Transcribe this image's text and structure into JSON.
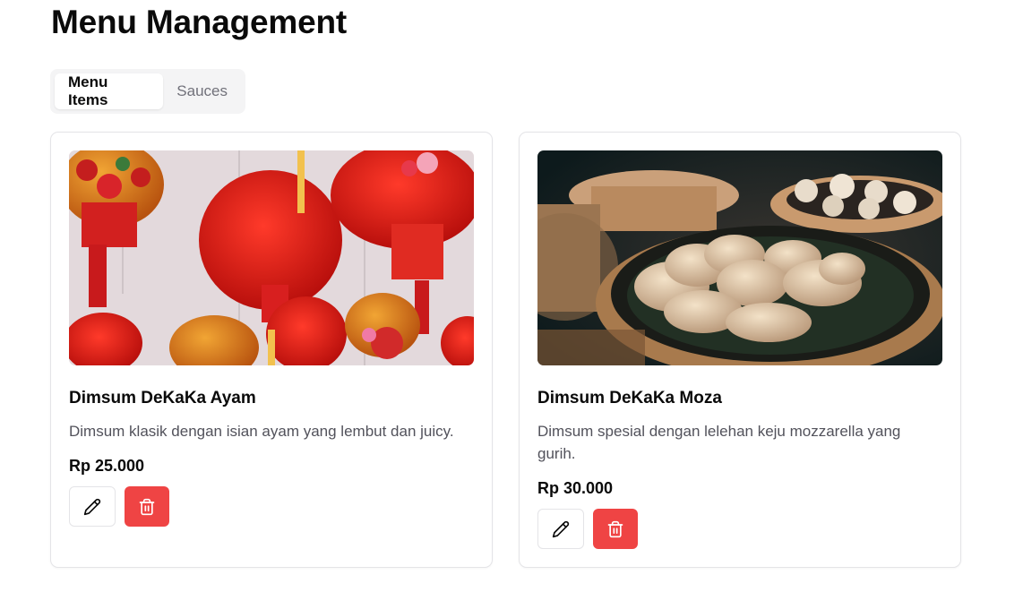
{
  "page": {
    "title": "Menu Management"
  },
  "tabs": [
    {
      "label": "Menu Items",
      "active": true
    },
    {
      "label": "Sauces",
      "active": false
    }
  ],
  "menu_items": [
    {
      "name": "Dimsum DeKaKa Ayam",
      "description": "Dimsum klasik dengan isian ayam yang lembut dan juicy.",
      "price": "Rp 25.000",
      "image": "red-lanterns-photo"
    },
    {
      "name": "Dimsum DeKaKa Moza",
      "description": "Dimsum spesial dengan lelehan keju mozzarella yang gurih.",
      "price": "Rp 30.000",
      "image": "dimsum-steamer-photo"
    }
  ],
  "icons": {
    "edit": "pencil-icon",
    "delete": "trash-icon"
  },
  "colors": {
    "danger": "#ef4444",
    "border": "#e4e4e7",
    "tab_bg": "#f4f4f5"
  }
}
